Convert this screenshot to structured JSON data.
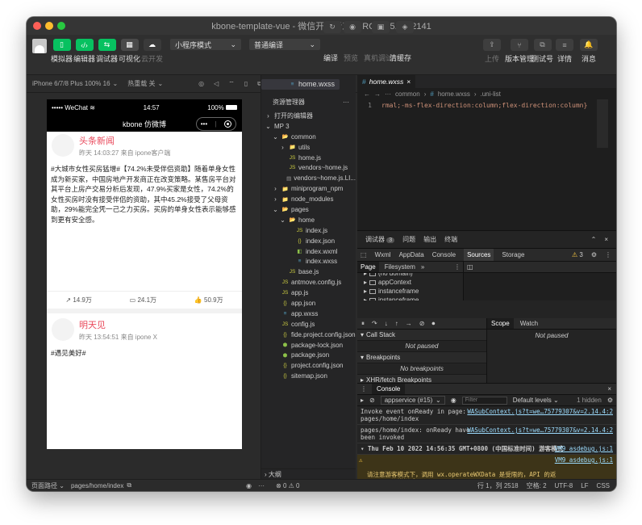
{
  "window": {
    "title": "kbone-template-vue - 微信开发者工具 RC 1.05.2112141"
  },
  "toolbar": {
    "left_buttons": [
      {
        "label": "模拟器",
        "color": "#07c160",
        "icon": "phone-icon"
      },
      {
        "label": "编辑器",
        "color": "#07c160",
        "icon": "code-icon"
      },
      {
        "label": "调试器",
        "color": "#07c160",
        "icon": "debug-icon"
      },
      {
        "label": "可视化",
        "color": "#4a4a4a",
        "icon": "visual-icon"
      },
      {
        "label": "云开发",
        "color": "#3a3a3a",
        "icon": "cloud-icon"
      }
    ],
    "mode_select": "小程序模式",
    "compile_select": "普通编译",
    "middle_buttons": [
      "编译",
      "预览",
      "真机调试",
      "清缓存"
    ],
    "right_buttons": [
      "上传",
      "版本管理",
      "测试号",
      "详情",
      "消息"
    ]
  },
  "simulator": {
    "device": "iPhone 6/7/8 Plus 100% 16",
    "hotreload": "热重载 关",
    "status_carrier": "WeChat",
    "status_time": "14:57",
    "status_battery": "100%",
    "nav_title": "kbone 仿微博",
    "posts": [
      {
        "name": "头条新闻",
        "meta": "昨天 14:03:27 来自 ipone客户端",
        "body": "#大城市女性买房猛增#【74.2%未受伴侣资助】随着单身女性成为新买家，中国房地产开发商正在改变策略。某售房平台对其平台上房产交易分析后发现，47.9%买家是女性，74.2%的女性买房时没有接受伴侣的资助，其中45.2%接受了父母资助，29%能完全凭一己之力买房。买房的单身女性表示能够感到更有安全感。",
        "reposts": "14.9万",
        "comments": "24.1万",
        "likes": "50.9万"
      },
      {
        "name": "明天见",
        "meta": "昨天 13:54:51 来自 ipone X",
        "body": "#遇见美好#"
      }
    ]
  },
  "explorer": {
    "title": "资源管理器",
    "open_editors": "打开的编辑器",
    "project": "MP 3",
    "items": [
      {
        "label": "common",
        "depth": 1,
        "kind": "folder-open"
      },
      {
        "label": "utils",
        "depth": 2,
        "kind": "folder"
      },
      {
        "label": "home.js",
        "depth": 2,
        "kind": "js"
      },
      {
        "label": "home.wxss",
        "depth": 2,
        "kind": "wxss",
        "selected": true
      },
      {
        "label": "vendors~home.js",
        "depth": 2,
        "kind": "js"
      },
      {
        "label": "vendors~home.js.LI...",
        "depth": 2,
        "kind": "file"
      },
      {
        "label": "miniprogram_npm",
        "depth": 1,
        "kind": "folder"
      },
      {
        "label": "node_modules",
        "depth": 1,
        "kind": "folder"
      },
      {
        "label": "pages",
        "depth": 1,
        "kind": "folder-open"
      },
      {
        "label": "home",
        "depth": 2,
        "kind": "folder-open"
      },
      {
        "label": "index.js",
        "depth": 3,
        "kind": "js"
      },
      {
        "label": "index.json",
        "depth": 3,
        "kind": "json"
      },
      {
        "label": "index.wxml",
        "depth": 3,
        "kind": "wxml"
      },
      {
        "label": "index.wxss",
        "depth": 3,
        "kind": "wxss"
      },
      {
        "label": "base.js",
        "depth": 2,
        "kind": "js"
      },
      {
        "label": "antmove.config.js",
        "depth": 1,
        "kind": "js"
      },
      {
        "label": "app.js",
        "depth": 1,
        "kind": "js"
      },
      {
        "label": "app.json",
        "depth": 1,
        "kind": "json"
      },
      {
        "label": "app.wxss",
        "depth": 1,
        "kind": "wxss"
      },
      {
        "label": "config.js",
        "depth": 1,
        "kind": "js"
      },
      {
        "label": "fide.project.config.json",
        "depth": 1,
        "kind": "json"
      },
      {
        "label": "package-lock.json",
        "depth": 1,
        "kind": "pkg"
      },
      {
        "label": "package.json",
        "depth": 1,
        "kind": "pkg"
      },
      {
        "label": "project.config.json",
        "depth": 1,
        "kind": "json"
      },
      {
        "label": "sitemap.json",
        "depth": 1,
        "kind": "json"
      }
    ],
    "outline": "大纲"
  },
  "editor": {
    "tab": "home.wxss",
    "crumbs": [
      "common",
      "home.wxss",
      ".uni-list"
    ],
    "line_no": "1",
    "code": "rmal;-ms-flex-direction:column;flex-direction:column}"
  },
  "devtools": {
    "title": "调试器",
    "badge": "3",
    "top_tabs": [
      "问题",
      "输出",
      "终端"
    ],
    "tabs": [
      "Wxml",
      "AppData",
      "Console",
      "Sources",
      "Storage"
    ],
    "active_tab": "Sources",
    "warn_count": "3",
    "left_tabs": [
      "Page",
      "Filesystem"
    ],
    "tree": [
      "(no domain)",
      "appContext",
      "instanceframe",
      "instanceframe"
    ],
    "sections": [
      {
        "title": "Call Stack",
        "body": "Not paused"
      },
      {
        "title": "Breakpoints",
        "body": "No breakpoints"
      },
      {
        "title": "XHR/fetch Breakpoints"
      },
      {
        "title": "DOM Breakpoints"
      }
    ],
    "scope_tabs": [
      "Scope",
      "Watch"
    ],
    "scope_body": "Not paused"
  },
  "console": {
    "tab": "Console",
    "context": "appservice (#15)",
    "filter_placeholder": "Filter",
    "levels": "Default levels",
    "hidden": "1 hidden",
    "lines": [
      {
        "text": "Invoke event onReady in page:\npages/home/index",
        "src": "WASubContext.js?t=we…75779307&v=2.14.4:2"
      },
      {
        "text": "pages/home/index: onReady have\nbeen invoked",
        "src": "WASubContext.js?t=we…75779307&v=2.14.4:2"
      }
    ],
    "group": "Thu Feb 10 2022 14:56:35 GMT+0800 (中国标准时间) 游客模式",
    "group_src": "VM9 asdebug.js:1",
    "warning": "请注意游客模式下，调用 wx.operateWXData 是受限的，API 的返\n回是工具的模拟返回",
    "warning_src": "VM9 asdebug.js:1"
  },
  "statusbar": {
    "path_label": "页面路径",
    "path": "pages/home/index",
    "errors": "⊗ 0 ⚠ 0",
    "position": "行 1，列 2518",
    "spaces": "空格: 2",
    "encoding": "UTF-8",
    "eol": "LF",
    "lang": "CSS"
  }
}
